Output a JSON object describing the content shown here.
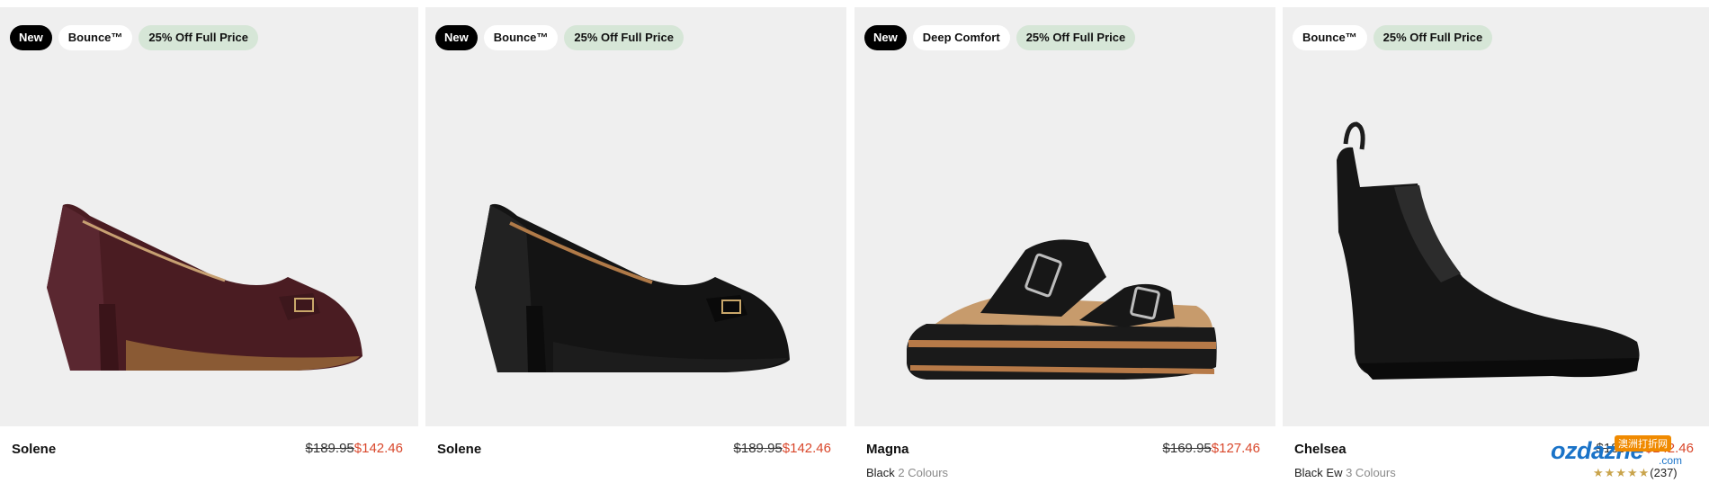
{
  "products": [
    {
      "name": "Solene",
      "badges": [
        "New",
        "Bounce™",
        "25% Off Full Price"
      ],
      "price_old": "$189.95",
      "price_new": "$142.46",
      "colour": "",
      "colour_count": ""
    },
    {
      "name": "Solene",
      "badges": [
        "New",
        "Bounce™",
        "25% Off Full Price"
      ],
      "price_old": "$189.95",
      "price_new": "$142.46",
      "colour": "",
      "colour_count": ""
    },
    {
      "name": "Magna",
      "badges": [
        "New",
        "Deep Comfort",
        "25% Off Full Price"
      ],
      "price_old": "$169.95",
      "price_new": "$127.46",
      "colour": "Black",
      "colour_count": "2 Colours"
    },
    {
      "name": "Chelsea",
      "badges": [
        "Bounce™",
        "25% Off Full Price"
      ],
      "price_old": "$189.95",
      "price_new": "$142.46",
      "colour": "Black Ew",
      "colour_count": "3 Colours",
      "rating_stars": "★★★★★",
      "rating_count": "(237)"
    }
  ],
  "watermark": {
    "logo": "ozdazhe",
    "domain": ".com",
    "chinese": "澳洲打折网"
  },
  "colors": {
    "card_bg": "#efefef",
    "badge_new_bg": "#000000",
    "badge_sale_bg": "#d6e6d7",
    "sale_price": "#d9472b"
  }
}
